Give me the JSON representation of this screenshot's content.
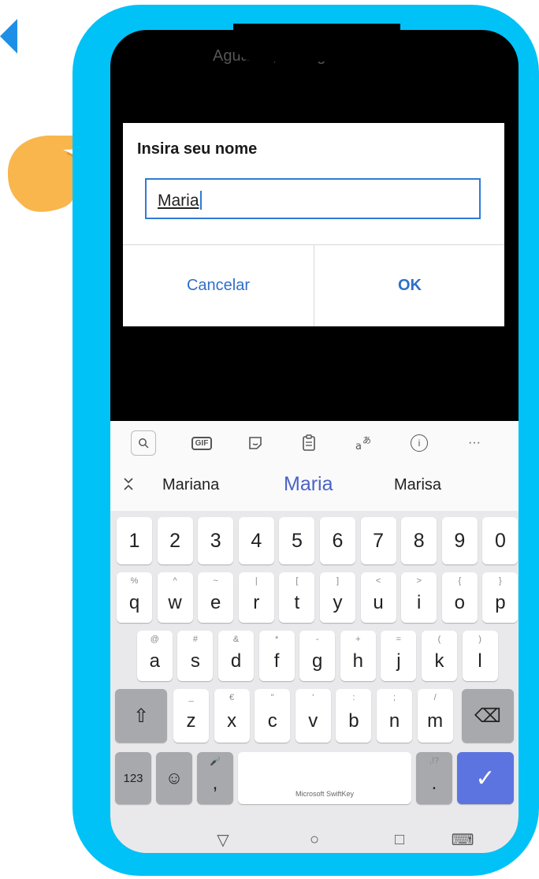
{
  "status_bar": {
    "text": "Aguarde, carregando..."
  },
  "dialog": {
    "title": "Insira seu nome",
    "input_value": "Maria",
    "cancel_label": "Cancelar",
    "ok_label": "OK"
  },
  "keyboard": {
    "toolbar": [
      {
        "icon": "search-icon"
      },
      {
        "icon": "gif-icon",
        "label": "GIF"
      },
      {
        "icon": "sticker-icon"
      },
      {
        "icon": "clipboard-icon"
      },
      {
        "icon": "translate-icon"
      },
      {
        "icon": "info-icon",
        "label": "i"
      },
      {
        "icon": "more-icon",
        "label": "···"
      }
    ],
    "suggestions": [
      "Mariana",
      "Maria",
      "Marisa"
    ],
    "numbers": [
      "1",
      "2",
      "3",
      "4",
      "5",
      "6",
      "7",
      "8",
      "9",
      "0"
    ],
    "row1": [
      [
        "q",
        "%"
      ],
      [
        "w",
        "^"
      ],
      [
        "e",
        "~"
      ],
      [
        "r",
        "|"
      ],
      [
        "t",
        "["
      ],
      [
        "y",
        "]"
      ],
      [
        "u",
        "<"
      ],
      [
        "i",
        ">"
      ],
      [
        "o",
        "{"
      ],
      [
        "p",
        "}"
      ]
    ],
    "row2": [
      [
        "a",
        "@"
      ],
      [
        "s",
        "#"
      ],
      [
        "d",
        "&"
      ],
      [
        "f",
        "*"
      ],
      [
        "g",
        "-"
      ],
      [
        "h",
        "+"
      ],
      [
        "j",
        "="
      ],
      [
        "k",
        "("
      ],
      [
        "l",
        ")"
      ]
    ],
    "row3": [
      [
        "z",
        "_"
      ],
      [
        "x",
        "€"
      ],
      [
        "c",
        "\""
      ],
      [
        "v",
        "'"
      ],
      [
        "b",
        ":"
      ],
      [
        "n",
        ";"
      ],
      [
        "m",
        "/"
      ]
    ],
    "bottom": {
      "numbers_label": "123",
      "emoji_label": "☺",
      "comma_label": ",",
      "comma_sec": "🎤",
      "space_brand": "Microsoft SwiftKey",
      "period_label": ".",
      "period_sec": ",!?",
      "shift_label": "⇧",
      "backspace_label": "⌫",
      "enter_label": "✓"
    }
  },
  "navbar": {
    "back": "▽",
    "home": "○",
    "recents": "□",
    "keyboard": "⌨"
  },
  "colors": {
    "frame": "#00c2f7",
    "accent": "#2e6fc8",
    "enter": "#5b74e0",
    "hand": "#f8b64c"
  }
}
